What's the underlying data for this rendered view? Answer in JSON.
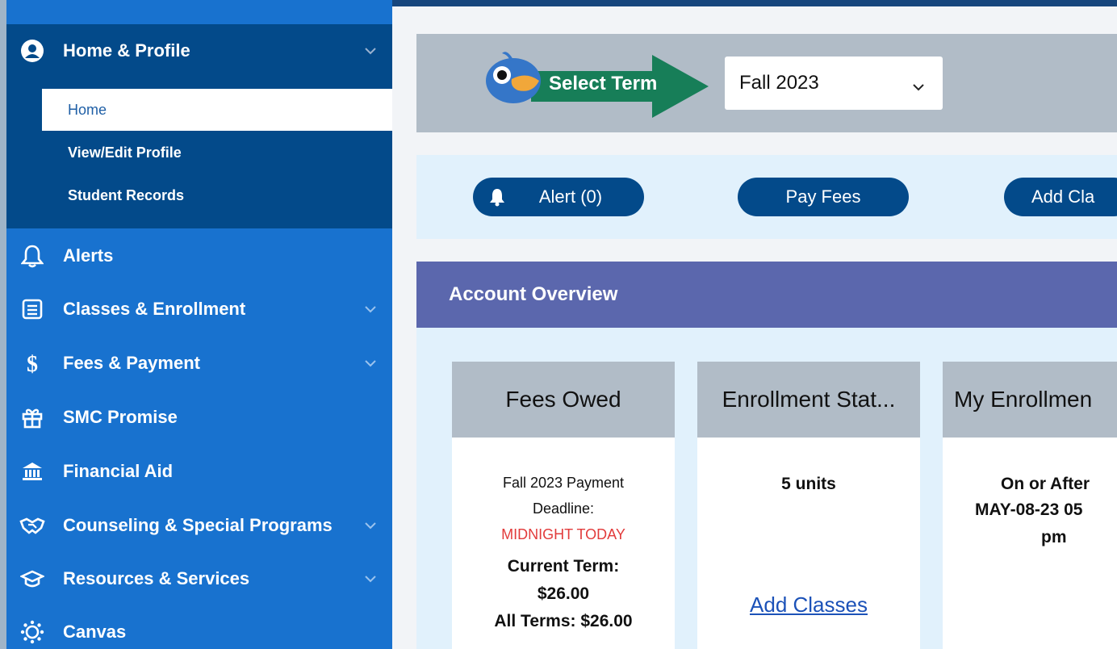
{
  "sidebar": {
    "home_group": {
      "label": "Home & Profile",
      "icon": "user-circle-icon",
      "items": [
        {
          "label": "Home",
          "active": true
        },
        {
          "label": "View/Edit Profile"
        },
        {
          "label": "Student Records"
        }
      ]
    },
    "items": [
      {
        "label": "Alerts",
        "icon": "bell-icon",
        "expandable": false
      },
      {
        "label": "Classes & Enrollment",
        "icon": "list-icon",
        "expandable": true
      },
      {
        "label": "Fees & Payment",
        "icon": "dollar-icon",
        "expandable": true
      },
      {
        "label": "SMC Promise",
        "icon": "gift-icon",
        "expandable": false
      },
      {
        "label": "Financial Aid",
        "icon": "bank-icon",
        "expandable": false
      },
      {
        "label": "Counseling & Special Programs",
        "icon": "handshake-icon",
        "expandable": true
      },
      {
        "label": "Resources & Services",
        "icon": "graduation-cap-icon",
        "expandable": true
      },
      {
        "label": "Canvas",
        "icon": "canvas-icon",
        "expandable": false
      }
    ]
  },
  "term_bar": {
    "select_label": "Select Term",
    "selected_term": "Fall 2023"
  },
  "actions": {
    "alert": "Alert (0)",
    "pay_fees": "Pay Fees",
    "add_classes": "Add Cla"
  },
  "overview": {
    "title": "Account Overview",
    "cards": {
      "fees": {
        "title": "Fees Owed",
        "deadline_line1": "Fall 2023 Payment",
        "deadline_line2": "Deadline:",
        "deadline_value": "MIDNIGHT TODAY",
        "current_term_label": "Current Term:",
        "current_term_value": "$26.00",
        "all_terms": "All Terms: $26.00"
      },
      "enrollment_status": {
        "title": "Enrollment Stat...",
        "units": "5 units",
        "link": "Add Classes"
      },
      "my_enrollment": {
        "title": "My Enrollmen",
        "line1": "On or After",
        "line2": "MAY-08-23 05",
        "line3": "pm"
      }
    }
  },
  "colors": {
    "sidebar": "#1872cf",
    "sidebar_group": "#034a8a",
    "overview_header": "#5b67ad",
    "panel_bg": "#e1f1fc",
    "card_header": "#b1bcc7",
    "alert_red": "#e23b3b",
    "arrow_green": "#177e58"
  }
}
